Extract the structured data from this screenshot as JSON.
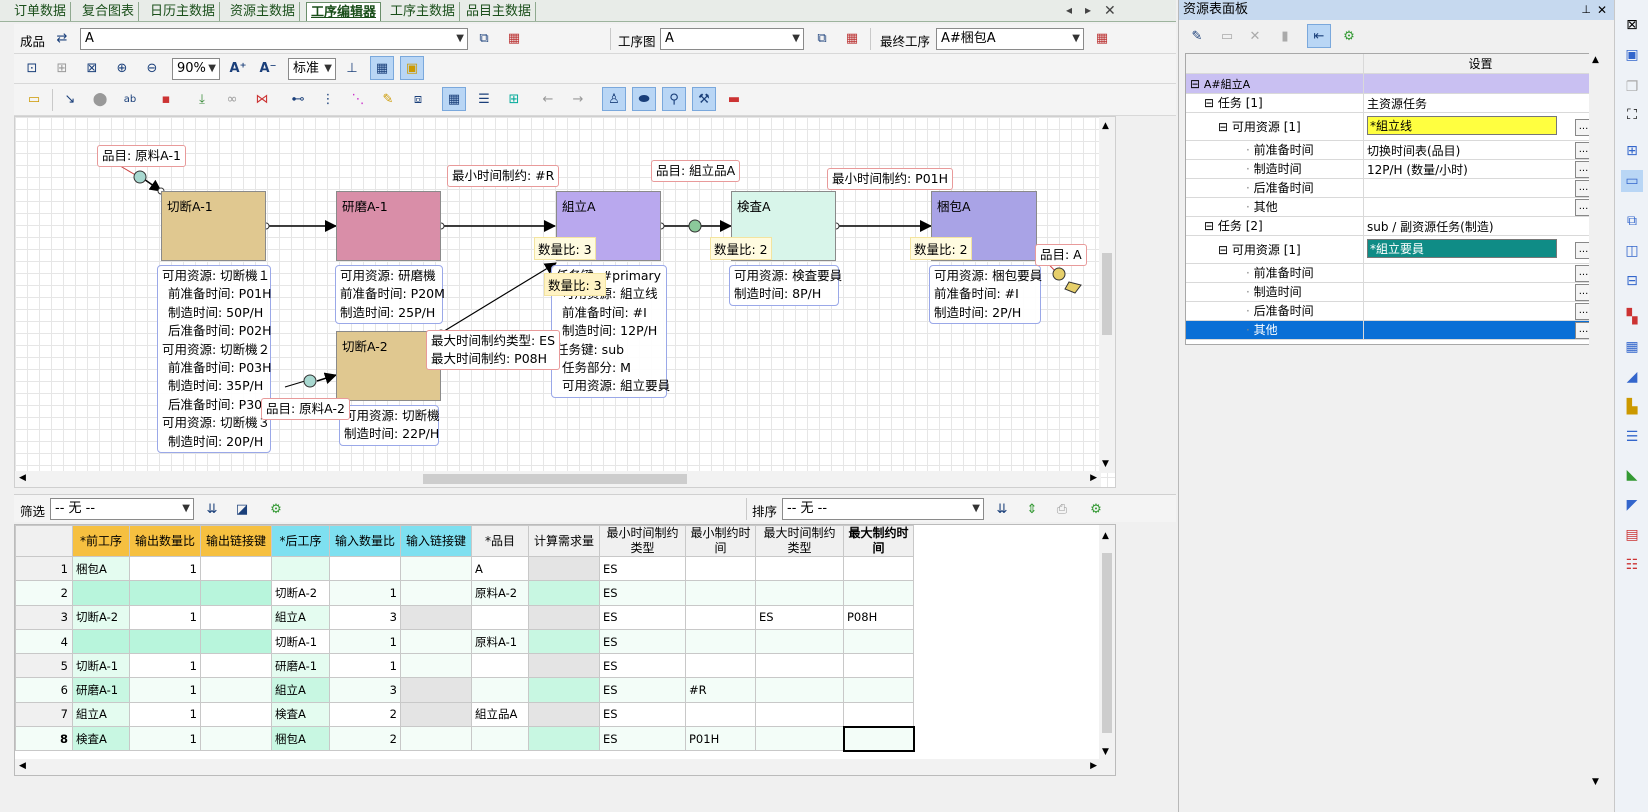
{
  "tabs": [
    "订单数据",
    "复合图表",
    "日历主数据",
    "资源主数据",
    "工序编辑器",
    "工序主数据",
    "品目主数据"
  ],
  "active_tab": "工序编辑器",
  "toolbar1": {
    "product_label": "成品",
    "product_value": "A",
    "process_map_label": "工序图",
    "process_map_value": "A",
    "final_process_label": "最终工序",
    "final_process_value": "A#梱包A"
  },
  "toolbar2": {
    "zoom": "90%",
    "style": "标准"
  },
  "canvas": {
    "nodes": {
      "cut1": "切断A-1",
      "grind1": "研磨A-1",
      "assemble": "組立A",
      "inspect": "検査A",
      "pack": "梱包A",
      "cut2": "切断A-2"
    },
    "tags": {
      "item_raw1": "品目: 原料A-1",
      "min_time_r": "最小时间制约: #R",
      "item_assemble": "品目: 組立品A",
      "min_time_p01h": "最小时间制约: P01H",
      "item_a": "品目: A",
      "item_raw2": "品目: 原料A-2",
      "max_type": "最大时间制约类型: ES",
      "max_time": "最大时间制约: P08H"
    },
    "qty": {
      "assemble": "数量比: 3",
      "assemble_overlap": "数量比: 3",
      "inspect": "数量比: 2",
      "pack": "数量比: 2"
    },
    "info": {
      "cut1": [
        "可用资源: 切断機１",
        "  前准备时间: P01H",
        "  制造时间: 50P/H",
        "  后准备时间: P02H",
        "可用资源: 切断機２",
        "  前准备时间: P03H",
        "  制造时间: 35P/H",
        "  后准备时间: P30M",
        "可用资源: 切断機３",
        "  制造时间: 20P/H"
      ],
      "grind1": [
        "可用资源: 研磨機",
        "前准备时间: P20M",
        "制造时间: 25P/H"
      ],
      "assemble": [
        "任务键: #primary",
        "  可用资源: 組立线",
        "  前准备时间: #I",
        "  制造时间: 12P/H",
        "任务键: sub",
        "  任务部分: M",
        "  可用资源: 組立要員"
      ],
      "inspect": [
        "可用资源: 検査要員",
        "制造时间: 8P/H"
      ],
      "pack": [
        "可用资源: 梱包要員",
        "前准备时间: #I",
        "制造时间: 2P/H"
      ],
      "cut2": [
        "可用资源: 切断機",
        "制造时间: 22P/H"
      ]
    }
  },
  "filter": {
    "label": "筛选",
    "value": "-- 无 --",
    "sort_label": "排序",
    "sort_value": "-- 无 --"
  },
  "grid": {
    "headers": [
      "*前工序",
      "输出数量比",
      "输出链接键",
      "*后工序",
      "输入数量比",
      "输入链接键",
      "*品目",
      "计算需求量",
      "最小时间制约类型",
      "最小制约时间",
      "最大时间制约类型",
      "最大制约时间"
    ],
    "rows": [
      [
        "1",
        "梱包A",
        "1",
        "",
        "",
        "",
        "",
        "A",
        "",
        "ES",
        "",
        "",
        ""
      ],
      [
        "2",
        "",
        "",
        "",
        "切断A-2",
        "1",
        "",
        "原料A-2",
        "",
        "ES",
        "",
        "",
        ""
      ],
      [
        "3",
        "切断A-2",
        "1",
        "",
        "組立A",
        "3",
        "",
        "",
        "",
        "ES",
        "",
        "ES",
        "P08H"
      ],
      [
        "4",
        "",
        "",
        "",
        "切断A-1",
        "1",
        "",
        "原料A-1",
        "",
        "ES",
        "",
        "",
        ""
      ],
      [
        "5",
        "切断A-1",
        "1",
        "",
        "研磨A-1",
        "1",
        "",
        "",
        "",
        "ES",
        "",
        "",
        ""
      ],
      [
        "6",
        "研磨A-1",
        "1",
        "",
        "組立A",
        "3",
        "",
        "",
        "",
        "ES",
        "#R",
        "",
        ""
      ],
      [
        "7",
        "組立A",
        "1",
        "",
        "検査A",
        "2",
        "",
        "組立品A",
        "",
        "ES",
        "",
        "",
        ""
      ],
      [
        "8",
        "検査A",
        "1",
        "",
        "梱包A",
        "2",
        "",
        "",
        "",
        "ES",
        "P01H",
        "",
        ""
      ]
    ]
  },
  "resource_panel": {
    "title": "资源表面板",
    "column_header": "设置",
    "rows": [
      {
        "key": "A#組立A",
        "value": ""
      },
      {
        "key": "任务 [1]",
        "value": "主资源任务"
      },
      {
        "key": "可用资源 [1]",
        "value": "*組立线"
      },
      {
        "key": "前准备时间",
        "value": "切换时间表(品目)"
      },
      {
        "key": "制造时间",
        "value": "12P/H (数量/小时)"
      },
      {
        "key": "后准备时间",
        "value": ""
      },
      {
        "key": "其他",
        "value": ""
      },
      {
        "key": "任务 [2]",
        "value": "sub / 副资源任务(制造)"
      },
      {
        "key": "可用资源 [1]",
        "value": "*組立要員"
      },
      {
        "key": "前准备时间",
        "value": ""
      },
      {
        "key": "制造时间",
        "value": ""
      },
      {
        "key": "后准备时间",
        "value": ""
      },
      {
        "key": "其他",
        "value": ""
      }
    ]
  },
  "colors": {
    "cut": "#e0c890",
    "grind": "#d98ea8",
    "assemble": "#b9a8ee",
    "inspect": "#d8f5ea",
    "pack": "#a9a3e6",
    "header_pre": "#f6c040",
    "header_post": "#7ee0f0",
    "yellow_cell": "#ffff40",
    "teal_cell": "#0f8c86",
    "selected_row": "#0a6fd6"
  }
}
